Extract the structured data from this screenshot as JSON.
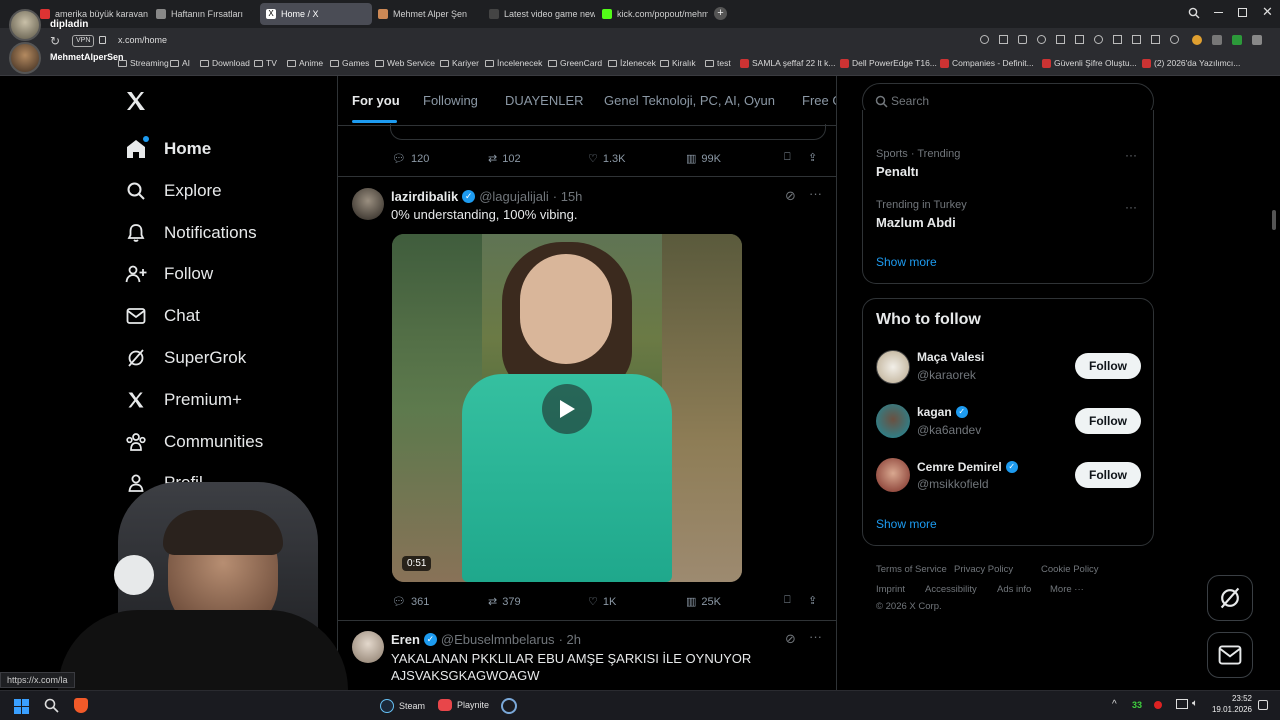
{
  "overlay": {
    "top_user": "dipladin",
    "bottom_user": "MehmetAlperSen"
  },
  "browser": {
    "tabs": [
      {
        "title": "amerika büyük karavan - ",
        "fav": "#d33"
      },
      {
        "title": "Haftanın Fırsatları",
        "fav": "#888"
      },
      {
        "title": "Home / X",
        "fav": "#fff"
      },
      {
        "title": "Mehmet Alper Şen",
        "fav": "#c85"
      },
      {
        "title": "Latest video game news a",
        "fav": "#444"
      },
      {
        "title": "kick.com/popout/mehmet",
        "fav": "#53fc18"
      }
    ],
    "vpn_label": "VPN",
    "url": "x.com/home",
    "bookmarks": [
      "Streaming",
      "AI",
      "Download",
      "TV",
      "Anime",
      "Games",
      "Web Service",
      "Kariyer",
      "İncelenecek",
      "GreenCard",
      "İzlenecek",
      "Kiralık",
      "test",
      "SAMLA şeffaf 22 lt k...",
      "Dell PowerEdge T16...",
      "Companies - Definit...",
      "Güvenli Şifre Oluştu...",
      "(2) 2026'da Yazılımcı..."
    ]
  },
  "nav": {
    "items": [
      {
        "label": "Home"
      },
      {
        "label": "Explore"
      },
      {
        "label": "Notifications"
      },
      {
        "label": "Follow"
      },
      {
        "label": "Chat"
      },
      {
        "label": "SuperGrok"
      },
      {
        "label": "Premium+"
      },
      {
        "label": "Communities"
      },
      {
        "label": "Profil"
      }
    ]
  },
  "feed": {
    "tabs": [
      "For you",
      "Following",
      "DUAYENLER",
      "Genel Teknoloji, PC, AI, Oyun",
      "Free G"
    ],
    "prev_actions": {
      "reply": "120",
      "repost": "102",
      "like": "1.3K",
      "views": "99K"
    },
    "tweet1": {
      "name": "lazirdibalik",
      "handle": "@lagujalijali",
      "time": "· 15h",
      "text": "0% understanding, 100% vibing.",
      "duration": "0:51",
      "actions": {
        "reply": "361",
        "repost": "379",
        "like": "1K",
        "views": "25K"
      }
    },
    "tweet2": {
      "name": "Eren",
      "handle": "@Ebuselmnbelarus",
      "time": "· 2h",
      "text_line1": "YAKALANAN PKKLILAR EBU AMŞE ŞARKISI İLE OYNUYOR",
      "text_line2": "AJSVAKSGKAGWOAGW"
    }
  },
  "sidebar": {
    "search_placeholder": "Search",
    "trends": [
      {
        "sub": "Sports · Trending",
        "title": "Penaltı"
      },
      {
        "sub": "Trending in Turkey",
        "title": "Mazlum Abdi"
      }
    ],
    "show_more": "Show more",
    "who_to_follow": {
      "title": "Who to follow",
      "users": [
        {
          "name": "Maça Valesi",
          "handle": "@karaorek",
          "verified": false
        },
        {
          "name": "kagan",
          "handle": "@ka6andev",
          "verified": true
        },
        {
          "name": "Cemre Demirel",
          "handle": "@msikkofield",
          "verified": true
        }
      ],
      "follow_label": "Follow",
      "show_more": "Show more"
    },
    "footer": {
      "line1": [
        "Terms of Service",
        "Privacy Policy",
        "Cookie Policy"
      ],
      "line2": [
        "Imprint",
        "Accessibility",
        "Ads info",
        "More ···"
      ],
      "copyright": "© 2026 X Corp."
    }
  },
  "status_url": "https://x.com/la",
  "taskbar": {
    "items": [
      "Steam",
      "Playnite"
    ],
    "time": "23:52",
    "date": "19.01.2026",
    "badge": "33"
  },
  "colors": {
    "accent": "#1d9bf0",
    "bg": "#000000",
    "border": "#2f3336",
    "muted": "#71767b"
  }
}
